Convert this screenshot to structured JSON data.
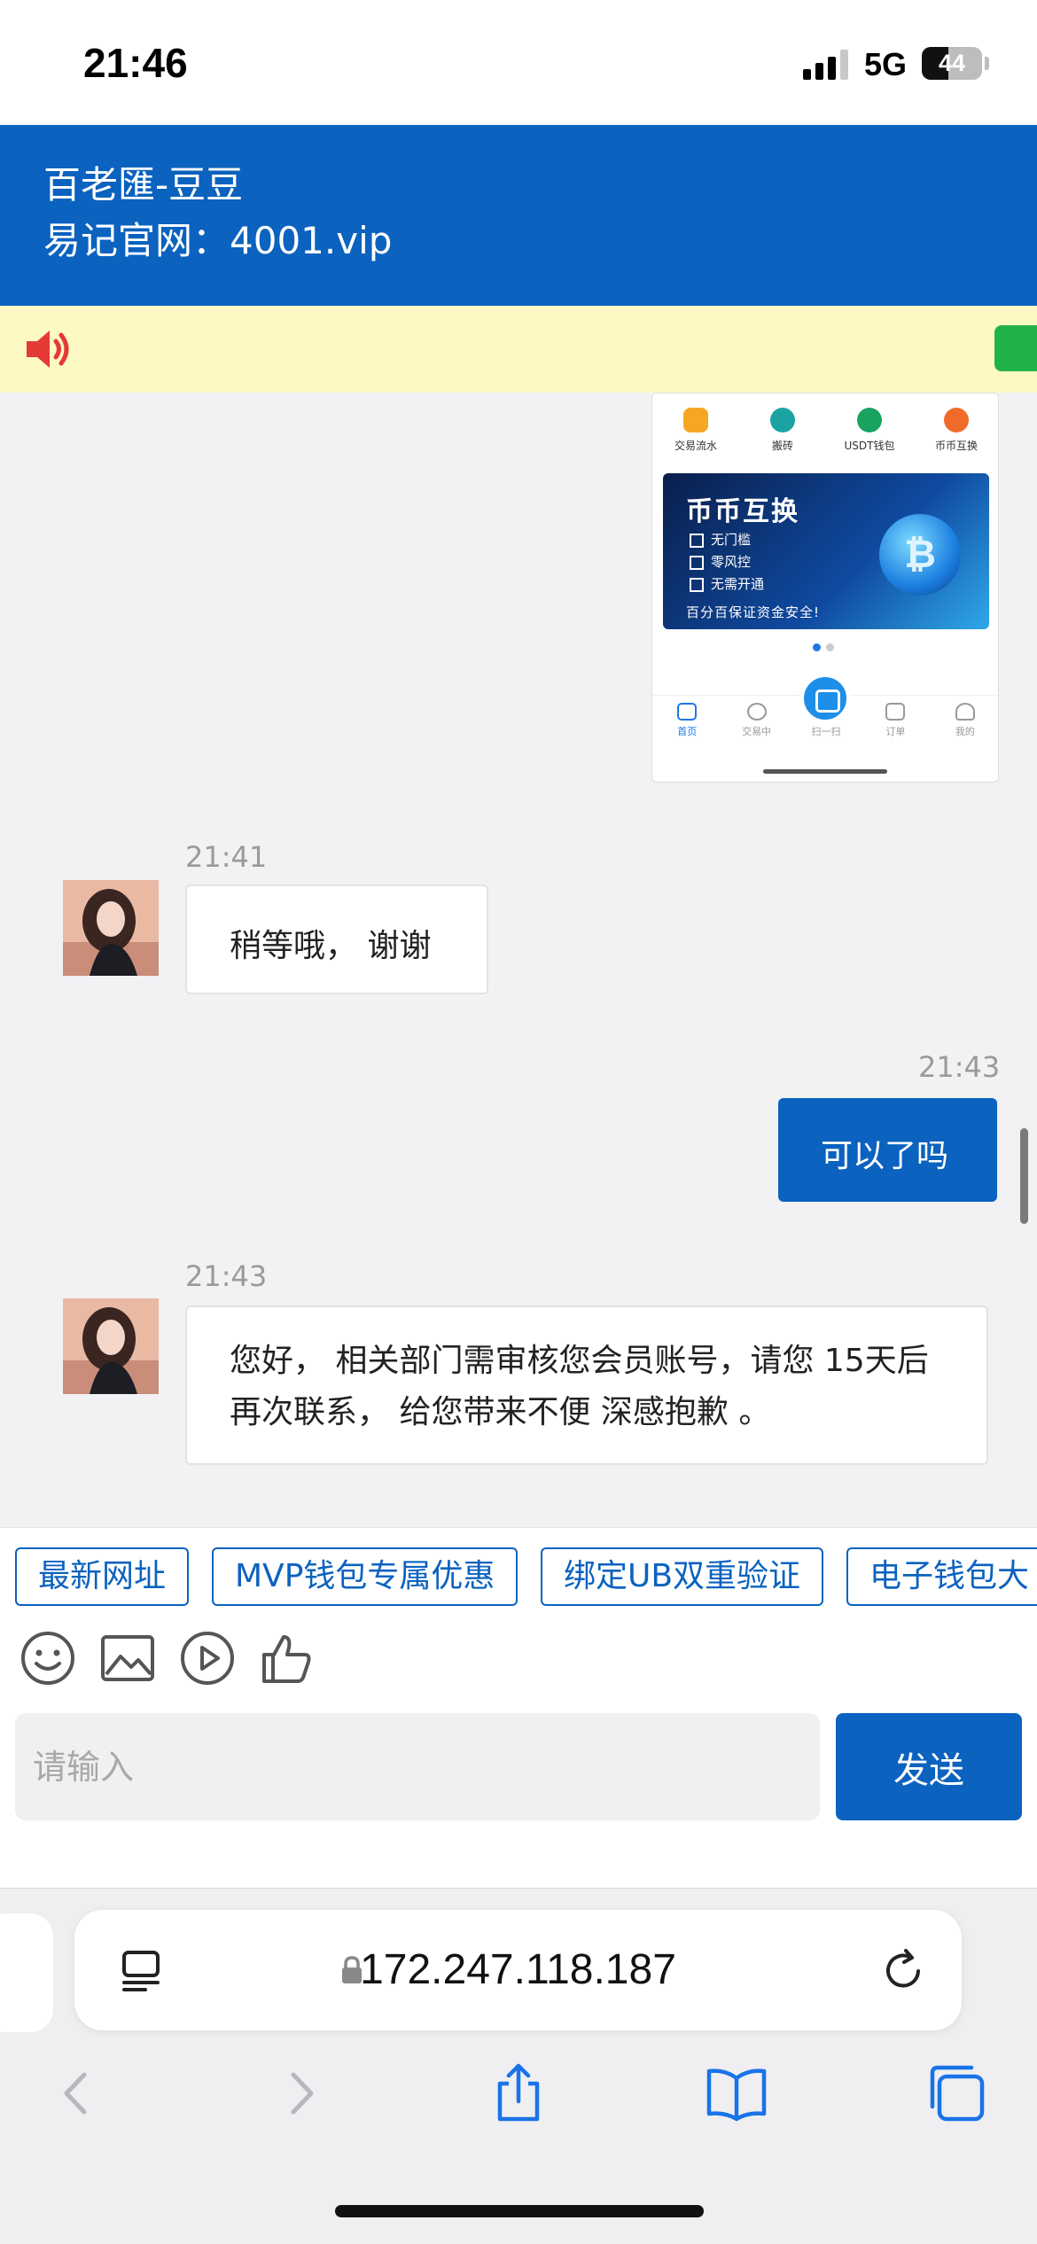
{
  "status_bar": {
    "time": "21:46",
    "network": "5G",
    "battery": "44",
    "battery_level": 0.44
  },
  "header": {
    "title": "百老匯-豆豆",
    "subtitle": "易记官网：4001.vip"
  },
  "colors": {
    "brand": "#0b62bf",
    "notice_bg": "#fdf9c4",
    "speaker": "#e53935"
  },
  "shared_screenshot": {
    "icons": [
      {
        "label": "交易流水",
        "color": "#f5a623"
      },
      {
        "label": "搬砖",
        "color": "#1ba3a3"
      },
      {
        "label": "USDT钱包",
        "color": "#1aa260"
      },
      {
        "label": "币币互换",
        "color": "#f06b2a"
      }
    ],
    "banner": {
      "title": "币币互换",
      "lines": [
        "无门槛",
        "零风控",
        "无需开通"
      ],
      "footer": "百分百保证资金安全!",
      "coin_symbol": "₿"
    },
    "nav": [
      "首页",
      "交易中",
      "扫一扫",
      "订单",
      "我的"
    ]
  },
  "messages": [
    {
      "time": "21:41",
      "text": "稍等哦， 谢谢",
      "side": "agent"
    },
    {
      "time": "21:43",
      "text": "可以了吗",
      "side": "me"
    },
    {
      "time": "21:43",
      "text": "您好， 相关部门需审核您会员账号，请您 15天后再次联系， 给您带来不便 深感抱歉 。",
      "side": "agent"
    }
  ],
  "quick_replies": [
    "最新网址",
    "MVP钱包专属优惠",
    "绑定UB双重验证",
    "电子钱包大"
  ],
  "toolbar_icons": [
    "emoji-icon",
    "image-icon",
    "video-icon",
    "thumbs-up-icon"
  ],
  "composer": {
    "placeholder": "请输入",
    "send_label": "发送"
  },
  "browser": {
    "url": "172.247.118.187"
  }
}
